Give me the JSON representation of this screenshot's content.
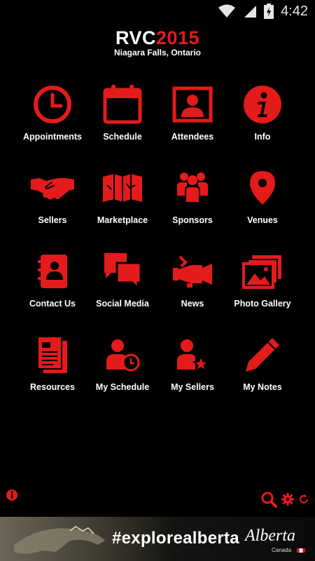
{
  "status": {
    "time": "4:42"
  },
  "header": {
    "logo_main": "RVC",
    "logo_year": "2015",
    "subtitle": "Niagara Falls, Ontario"
  },
  "tiles": [
    {
      "label": "Appointments",
      "icon": "clock-icon"
    },
    {
      "label": "Schedule",
      "icon": "calendar-icon"
    },
    {
      "label": "Attendees",
      "icon": "person-frame-icon"
    },
    {
      "label": "Info",
      "icon": "info-icon"
    },
    {
      "label": "Sellers",
      "icon": "handshake-icon"
    },
    {
      "label": "Marketplace",
      "icon": "map-icon"
    },
    {
      "label": "Sponsors",
      "icon": "group-icon"
    },
    {
      "label": "Venues",
      "icon": "location-pin-icon"
    },
    {
      "label": "Contact Us",
      "icon": "address-book-icon"
    },
    {
      "label": "Social Media",
      "icon": "chat-bubbles-icon"
    },
    {
      "label": "News",
      "icon": "megaphone-icon"
    },
    {
      "label": "Photo Gallery",
      "icon": "photo-stack-icon"
    },
    {
      "label": "Resources",
      "icon": "documents-icon"
    },
    {
      "label": "My Schedule",
      "icon": "person-clock-icon"
    },
    {
      "label": "My Sellers",
      "icon": "person-star-icon"
    },
    {
      "label": "My Notes",
      "icon": "pencil-icon"
    }
  ],
  "banner": {
    "hashtag": "#explorealberta",
    "brand": "Alberta",
    "country": "Canada"
  },
  "colors": {
    "accent": "#e31b1b",
    "background": "#000000"
  }
}
